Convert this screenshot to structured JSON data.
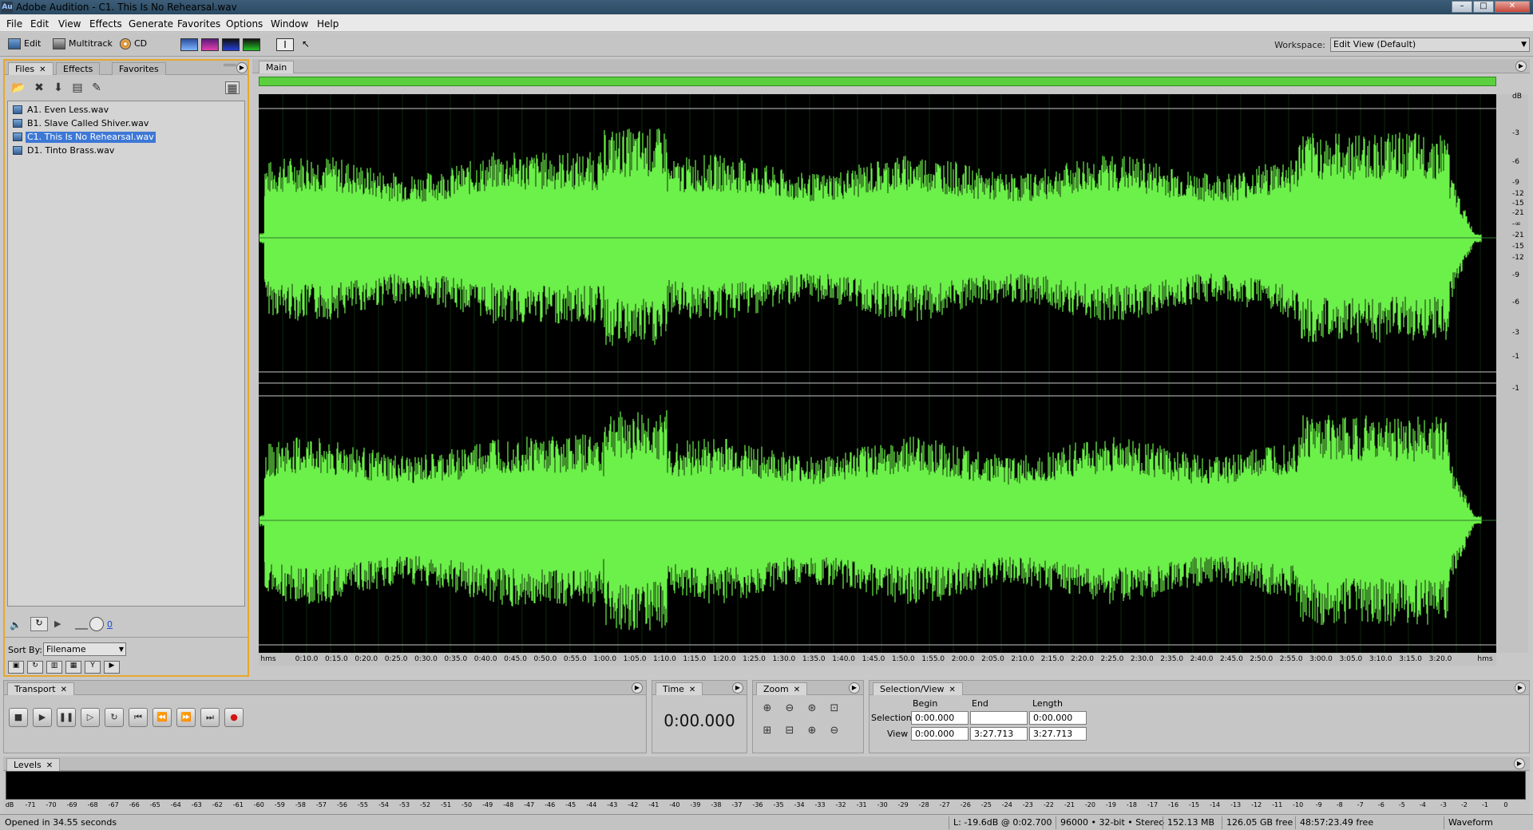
{
  "window": {
    "title": "Adobe Audition - C1. This Is No Rehearsal.wav",
    "app_icon": "Au",
    "minimize": "–",
    "maximize": "□",
    "close": "✕"
  },
  "menu": [
    "File",
    "Edit",
    "View",
    "Effects",
    "Generate",
    "Favorites",
    "Options",
    "Window",
    "Help"
  ],
  "toolbar": {
    "edit_label": "Edit",
    "multitrack_label": "Multitrack",
    "cd_label": "CD",
    "workspace_label": "Workspace:",
    "workspace_value": "Edit View (Default)"
  },
  "files_panel": {
    "tabs": [
      "Files",
      "Effects",
      "Favorites"
    ],
    "close_glyph": "✕",
    "files": [
      "A1. Even Less.wav",
      "B1. Slave Called Shiver.wav",
      "C1. This Is No Rehearsal.wav",
      "D1. Tinto Brass.wav"
    ],
    "selected_index": 2,
    "volume_value": "0",
    "sort_by_label": "Sort By:",
    "sort_by_value": "Filename"
  },
  "main_panel": {
    "tab": "Main",
    "db_label": "dB",
    "db_ticks": [
      "-3",
      "-6",
      "-9",
      "-12",
      "-15",
      "-21",
      "-∞",
      "-21",
      "-15",
      "-12",
      "-9",
      "-6",
      "-3",
      "-1",
      "-1"
    ],
    "time_unit": "hms",
    "time_ticks": [
      "0:10.0",
      "0:15.0",
      "0:20.0",
      "0:25.0",
      "0:30.0",
      "0:35.0",
      "0:40.0",
      "0:45.0",
      "0:50.0",
      "0:55.0",
      "1:00.0",
      "1:05.0",
      "1:10.0",
      "1:15.0",
      "1:20.0",
      "1:25.0",
      "1:30.0",
      "1:35.0",
      "1:40.0",
      "1:45.0",
      "1:50.0",
      "1:55.0",
      "2:00.0",
      "2:05.0",
      "2:10.0",
      "2:15.0",
      "2:20.0",
      "2:25.0",
      "2:30.0",
      "2:35.0",
      "2:40.0",
      "2:45.0",
      "2:50.0",
      "2:55.0",
      "3:00.0",
      "3:05.0",
      "3:10.0",
      "3:15.0",
      "3:20.0"
    ],
    "waveform_color": "#6cf04a"
  },
  "transport": {
    "title": "Transport",
    "buttons": [
      "stop",
      "play",
      "pause",
      "play-from-cursor",
      "loop",
      "go-to-start",
      "rewind",
      "fast-forward",
      "go-to-end",
      "record"
    ]
  },
  "time_panel": {
    "title": "Time",
    "value": "0:00.000"
  },
  "zoom_panel": {
    "title": "Zoom"
  },
  "selection_view": {
    "title": "Selection/View",
    "col_begin": "Begin",
    "col_end": "End",
    "col_length": "Length",
    "row_selection": "Selection",
    "row_view": "View",
    "selection_begin": "0:00.000",
    "selection_end": "",
    "selection_length": "0:00.000",
    "view_begin": "0:00.000",
    "view_end": "3:27.713",
    "view_length": "3:27.713"
  },
  "levels": {
    "title": "Levels",
    "scale": [
      "dB",
      "-71",
      "-70",
      "-69",
      "-68",
      "-67",
      "-66",
      "-65",
      "-64",
      "-63",
      "-62",
      "-61",
      "-60",
      "-59",
      "-58",
      "-57",
      "-56",
      "-55",
      "-54",
      "-53",
      "-52",
      "-51",
      "-50",
      "-49",
      "-48",
      "-47",
      "-46",
      "-45",
      "-44",
      "-43",
      "-42",
      "-41",
      "-40",
      "-39",
      "-38",
      "-37",
      "-36",
      "-35",
      "-34",
      "-33",
      "-32",
      "-31",
      "-30",
      "-29",
      "-28",
      "-27",
      "-26",
      "-25",
      "-24",
      "-23",
      "-22",
      "-21",
      "-20",
      "-19",
      "-18",
      "-17",
      "-16",
      "-15",
      "-14",
      "-13",
      "-12",
      "-11",
      "-10",
      "-9",
      "-8",
      "-7",
      "-6",
      "-5",
      "-4",
      "-3",
      "-2",
      "-1",
      "0"
    ]
  },
  "status": {
    "left": "Opened in 34.55 seconds",
    "level": "L: -19.6dB @  0:02.700",
    "format": "96000 • 32-bit • Stereo",
    "size": "152.13 MB",
    "free": "126.05 GB free",
    "time_free": "48:57:23.49 free",
    "mode": "Waveform"
  }
}
